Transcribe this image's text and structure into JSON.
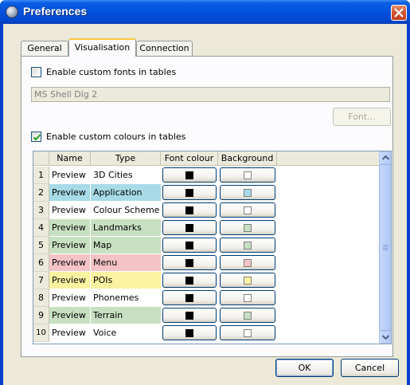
{
  "window": {
    "title": "Preferences"
  },
  "tabs": [
    {
      "label": "General"
    },
    {
      "label": "Visualisation",
      "active": true
    },
    {
      "label": "Connection"
    }
  ],
  "custom_fonts": {
    "label": "Enable custom fonts in tables",
    "checked": false,
    "font_value": "MS Shell Dlg 2",
    "font_button": "Font..."
  },
  "custom_colours": {
    "label": "Enable custom colours in tables",
    "checked": true
  },
  "table": {
    "headers": [
      "",
      "Name",
      "Type",
      "Font colour",
      "Background"
    ],
    "rows": [
      {
        "num": "1",
        "name": "Preview",
        "type": "3D Cities",
        "bg": "#ffffff",
        "font_colour": "#000000"
      },
      {
        "num": "2",
        "name": "Preview",
        "type": "Application",
        "bg": "#a7dbe8",
        "font_colour": "#000000"
      },
      {
        "num": "3",
        "name": "Preview",
        "type": "Colour Scheme",
        "bg": "#ffffff",
        "font_colour": "#000000"
      },
      {
        "num": "4",
        "name": "Preview",
        "type": "Landmarks",
        "bg": "#c8e0c2",
        "font_colour": "#000000"
      },
      {
        "num": "5",
        "name": "Preview",
        "type": "Map",
        "bg": "#c8e0c2",
        "font_colour": "#000000"
      },
      {
        "num": "6",
        "name": "Preview",
        "type": "Menu Language",
        "bg": "#f4c3c6",
        "font_colour": "#000000"
      },
      {
        "num": "7",
        "name": "Preview",
        "type": "POIs",
        "bg": "#fbf2a2",
        "font_colour": "#000000"
      },
      {
        "num": "8",
        "name": "Preview",
        "type": "Phonemes",
        "bg": "#ffffff",
        "font_colour": "#000000"
      },
      {
        "num": "9",
        "name": "Preview",
        "type": "Terrain",
        "bg": "#c8e0c2",
        "font_colour": "#000000"
      },
      {
        "num": "10",
        "name": "Preview",
        "type": "Voice Language",
        "bg": "#ffffff",
        "font_colour": "#000000"
      }
    ]
  },
  "buttons": {
    "ok": "OK",
    "cancel": "Cancel"
  },
  "colors": {
    "titlebar": "#0452dd",
    "dialog_bg": "#ece9d8",
    "tab_highlight": "#ffc83c"
  }
}
